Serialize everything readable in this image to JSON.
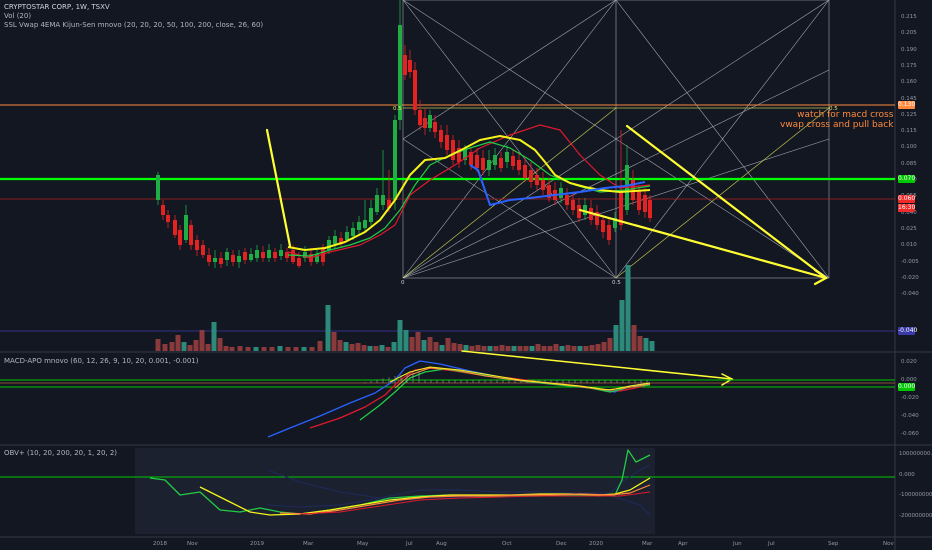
{
  "main_legend": {
    "title": "CRYPTOSTAR CORP, 1W, TSXV",
    "vol": "Vol (20)",
    "ssl": "SSL Vwap 4EMA Kijun-Sen mnovo (20, 20, 20, 50, 100, 200, close, 26, 60)"
  },
  "annotation": {
    "line1": "watch for macd cross",
    "line2": "vwap cross and pull back"
  },
  "fib_labels": [
    "0.5",
    "0",
    "0.5",
    "0.5"
  ],
  "price_axis": [
    "0.215",
    "0.205",
    "0.190",
    "0.175",
    "0.160",
    "0.145",
    "0.125",
    "0.115",
    "0.100",
    "0.085",
    "0.070",
    "0.055",
    "0.040",
    "0.025",
    "0.010",
    "-0.005",
    "-0.020",
    "-0.040"
  ],
  "price_tags": {
    "orange": "0.130",
    "green": "0.070",
    "red": "0.060",
    "red2": "16:30",
    "blue": "-0.040"
  },
  "macd": {
    "legend": "MACD-APO mnovo (60, 12, 26, 9, 10, 20, 0.001, -0.001)",
    "axis": [
      "0.020",
      "0.000",
      "-0.020",
      "-0.040",
      "-0.060"
    ],
    "tag": "0.000"
  },
  "obv": {
    "legend": "OBV+ (10, 20, 200, 20, 1, 20, 2)",
    "axis": [
      "100000000.000",
      "0.000",
      "-100000000.000",
      "-200000000.000"
    ]
  },
  "time_axis": [
    "2018",
    "Nov",
    "2019",
    "Mar",
    "May",
    "Jul",
    "Aug",
    "Oct",
    "Dec",
    "2020",
    "Mar",
    "Apr",
    "Jun",
    "Jul",
    "Sep",
    "Nov"
  ],
  "colors": {
    "background": "#131722",
    "up": "#26a641",
    "down": "#ef2b2b",
    "green_line": "#00ff00",
    "orange_line": "#ff8a3d",
    "yellow": "#ffff33",
    "red_line": "#cc2233",
    "blue": "#2962ff"
  }
}
